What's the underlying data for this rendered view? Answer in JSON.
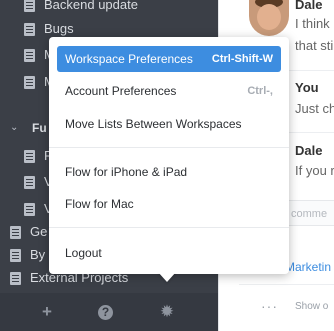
{
  "sidebar": {
    "items": [
      {
        "label": "Backend update"
      },
      {
        "label": "Bugs"
      },
      {
        "label": "M"
      },
      {
        "label": "M"
      }
    ],
    "group": {
      "label": "Fu"
    },
    "group_items": [
      {
        "label": "F"
      },
      {
        "label": "V"
      },
      {
        "label": "V"
      }
    ],
    "top_items": [
      {
        "label": "Ge"
      },
      {
        "label": "By"
      },
      {
        "label": "External Projects"
      }
    ],
    "footer": {
      "add_icon": "+",
      "help_icon": "?",
      "settings_icon": "✹"
    }
  },
  "comments": [
    {
      "name": "Dale",
      "lines": [
        "I think",
        "that sti"
      ]
    },
    {
      "name": "You",
      "lines": [
        "Just ch"
      ]
    },
    {
      "name": "Dale",
      "lines": [
        "If you r"
      ]
    }
  ],
  "comment_input": {
    "placeholder": "comme"
  },
  "link": {
    "label": "Marketin"
  },
  "pane_footer": {
    "dots": "···",
    "label": "Show o"
  },
  "menu": {
    "items": [
      {
        "label": "Workspace Preferences",
        "shortcut": "Ctrl-Shift-W"
      },
      {
        "label": "Account Preferences",
        "shortcut": "Ctrl-,"
      },
      {
        "label": "Move Lists Between Workspaces",
        "shortcut": ""
      },
      {
        "label": "Flow for iPhone & iPad",
        "shortcut": ""
      },
      {
        "label": "Flow for Mac",
        "shortcut": ""
      },
      {
        "label": "Logout",
        "shortcut": ""
      }
    ]
  },
  "colors": {
    "accent": "#3d8de0",
    "sidebar": "#3b3f47"
  }
}
